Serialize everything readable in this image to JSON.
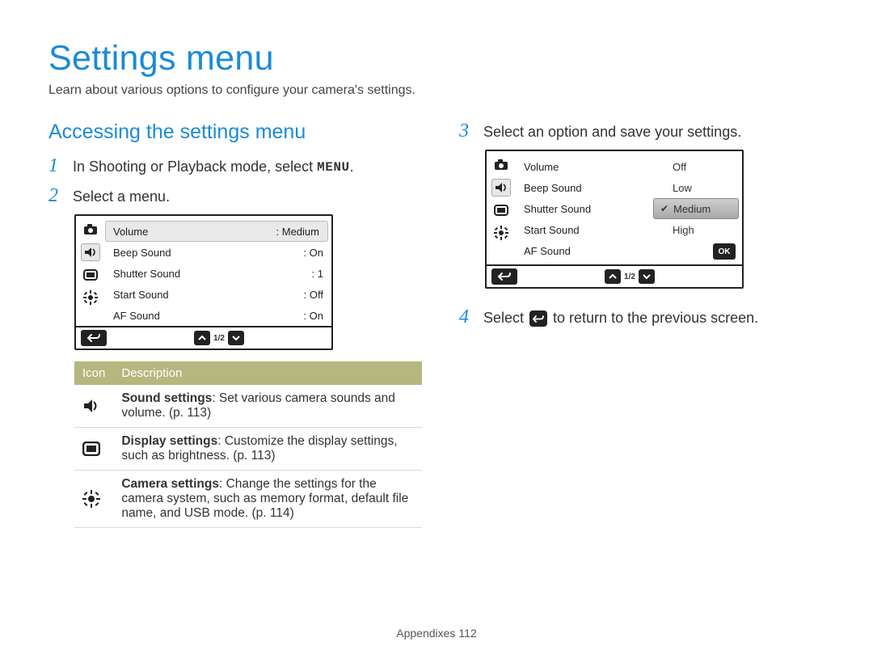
{
  "title": "Settings menu",
  "subtitle": "Learn about various options to configure your camera's settings.",
  "section_heading": "Accessing the settings menu",
  "steps": {
    "s1": {
      "num": "1",
      "prefix": "In Shooting or Playback mode, select ",
      "menu_token": "MENU",
      "suffix": "."
    },
    "s2": {
      "num": "2",
      "text": "Select a menu."
    },
    "s3": {
      "num": "3",
      "text": "Select an option and save your settings."
    },
    "s4": {
      "num": "4",
      "prefix": "Select ",
      "suffix": " to return to the previous screen."
    }
  },
  "screen1": {
    "rows": [
      {
        "label": "Volume",
        "value": "Medium"
      },
      {
        "label": "Beep Sound",
        "value": "On"
      },
      {
        "label": "Shutter Sound",
        "value": "1"
      },
      {
        "label": "Start Sound",
        "value": "Off"
      },
      {
        "label": "AF Sound",
        "value": "On"
      }
    ],
    "pager": "1/2"
  },
  "screen2": {
    "rows": [
      {
        "label": "Volume"
      },
      {
        "label": "Beep Sound"
      },
      {
        "label": "Shutter Sound"
      },
      {
        "label": "Start Sound"
      },
      {
        "label": "AF Sound"
      }
    ],
    "options": [
      {
        "label": "Off",
        "selected": false
      },
      {
        "label": "Low",
        "selected": false
      },
      {
        "label": "Medium",
        "selected": true
      },
      {
        "label": "High",
        "selected": false
      }
    ],
    "ok_label": "OK",
    "pager": "1/2"
  },
  "icon_table": {
    "headers": {
      "icon": "Icon",
      "desc": "Description"
    },
    "rows": [
      {
        "title": "Sound settings",
        "desc": ": Set various camera sounds and volume. (p. 113)"
      },
      {
        "title": "Display settings",
        "desc": ": Customize the display settings, such as brightness. (p. 113)"
      },
      {
        "title": "Camera settings",
        "desc": ": Change the settings for the camera system, such as memory format, default file name, and USB mode. (p. 114)"
      }
    ]
  },
  "footer": {
    "section": "Appendixes",
    "page": "112"
  }
}
